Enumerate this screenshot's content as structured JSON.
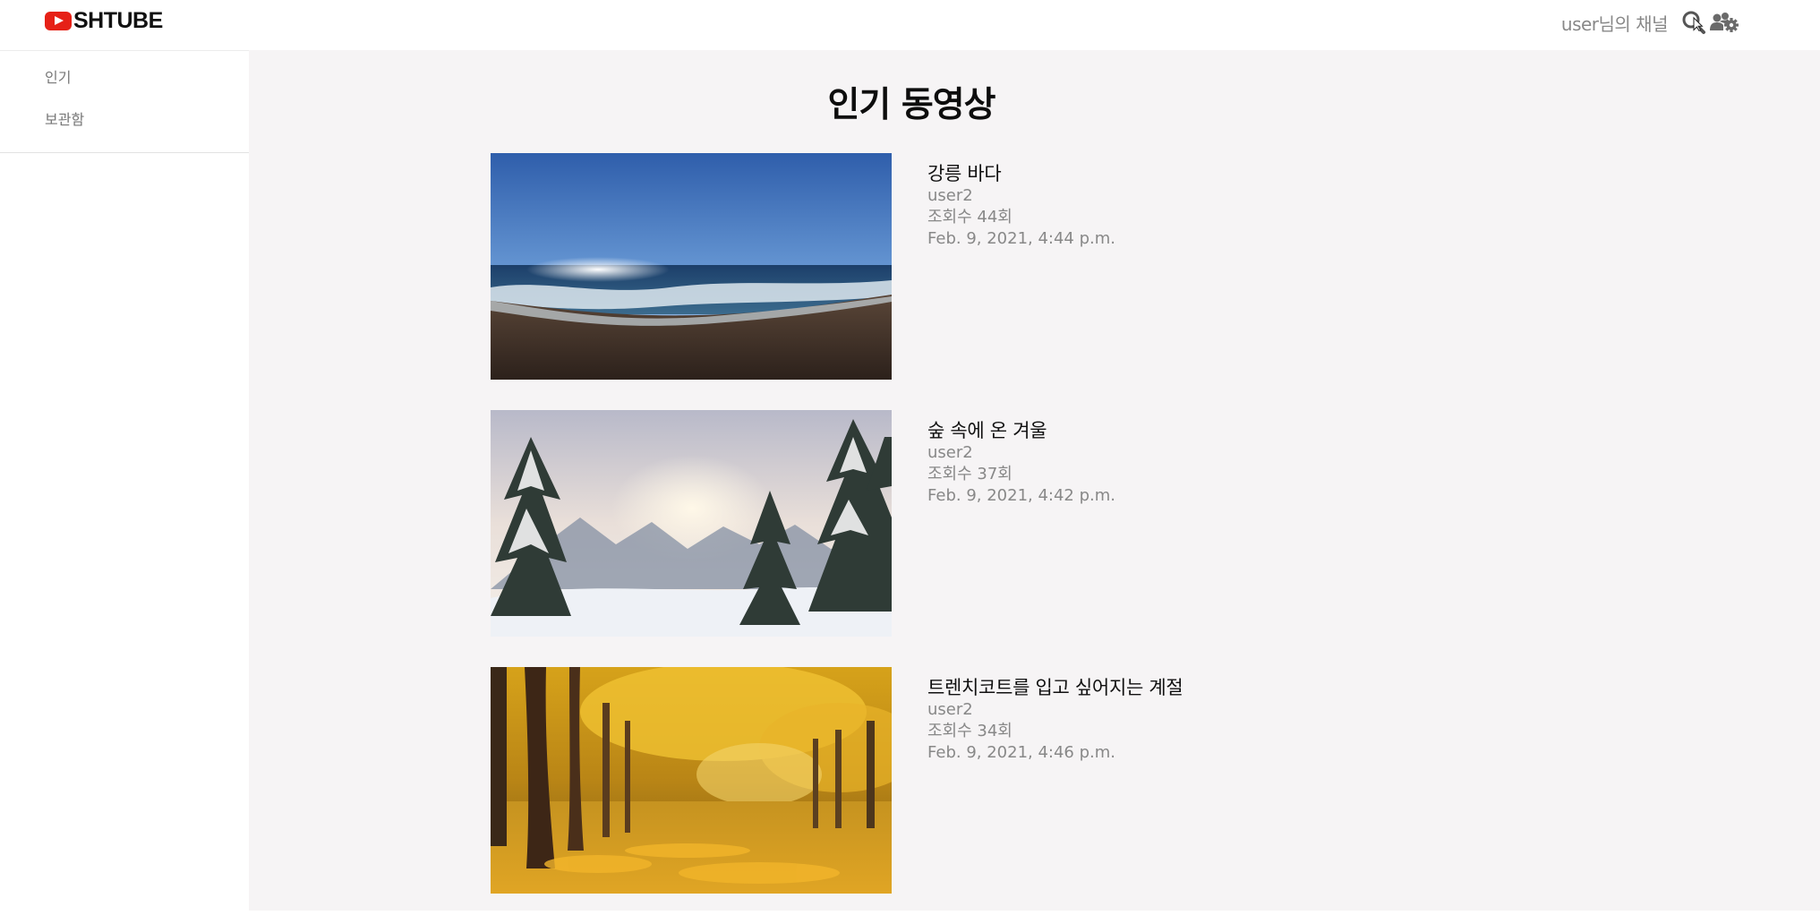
{
  "header": {
    "logo_text": "SHTUBE",
    "channel_link": "user님의 채널",
    "icons": [
      "search-icon",
      "users-gear-icon"
    ]
  },
  "sidebar": {
    "items": [
      {
        "label": "인기"
      },
      {
        "label": "보관함"
      }
    ]
  },
  "main": {
    "title": "인기 동영상",
    "videos": [
      {
        "title": "강릉 바다",
        "author": "user2",
        "views": "조회수 44회",
        "date": "Feb. 9, 2021, 4:44 p.m.",
        "thumbnail": "ocean-beach"
      },
      {
        "title": "숲 속에 온 겨울",
        "author": "user2",
        "views": "조회수 37회",
        "date": "Feb. 9, 2021, 4:42 p.m.",
        "thumbnail": "snowy-forest"
      },
      {
        "title": "트렌치코트를 입고 싶어지는 계절",
        "author": "user2",
        "views": "조회수 34회",
        "date": "Feb. 9, 2021, 4:46 p.m.",
        "thumbnail": "autumn-park"
      }
    ]
  },
  "colors": {
    "brand_red": "#e62117",
    "main_background": "#f6f4f5",
    "meta_text": "#888888"
  }
}
